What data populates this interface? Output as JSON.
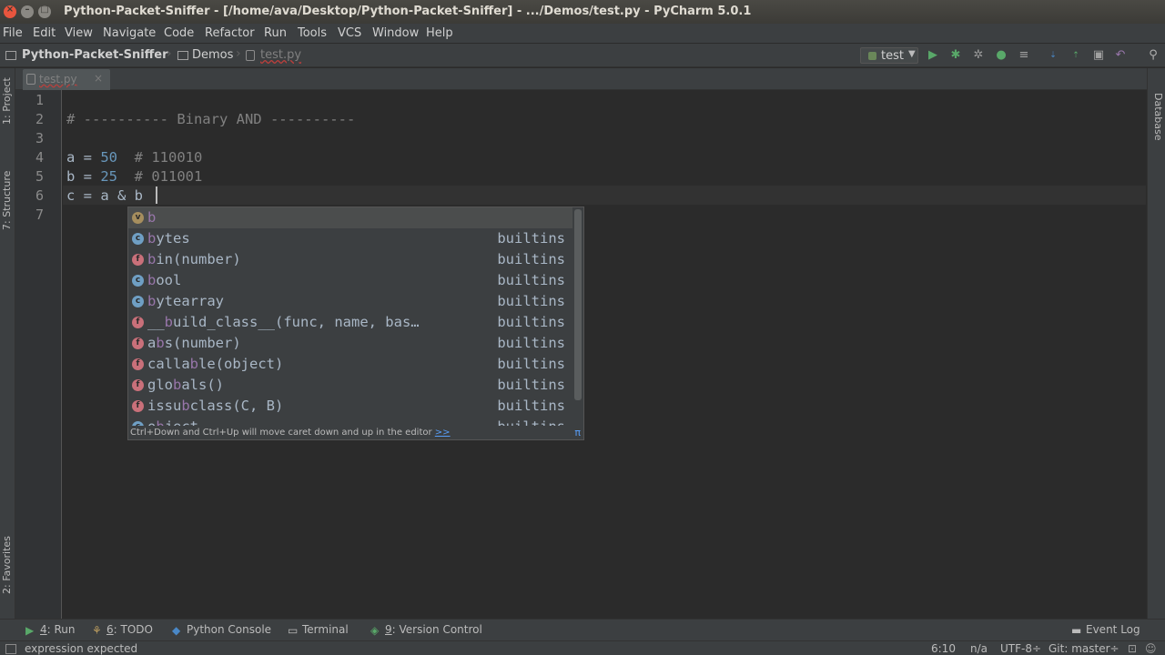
{
  "window": {
    "title": "Python-Packet-Sniffer - [/home/ava/Desktop/Python-Packet-Sniffer] - .../Demos/test.py - PyCharm 5.0.1"
  },
  "menu": {
    "items": [
      "File",
      "Edit",
      "View",
      "Navigate",
      "Code",
      "Refactor",
      "Run",
      "Tools",
      "VCS",
      "Window",
      "Help"
    ]
  },
  "navbar": {
    "project": "Python-Packet-Sniffer",
    "folder": "Demos",
    "file": "test.py",
    "run_config": "test"
  },
  "left_tool_tabs": [
    "1: Project",
    "7: Structure",
    "2: Favorites"
  ],
  "right_tool_tabs": [
    "Database"
  ],
  "editor": {
    "tab_name": "test.py",
    "line_numbers": [
      "1",
      "2",
      "3",
      "4",
      "5",
      "6",
      "7"
    ],
    "lines": {
      "l2_comment": "# ---------- Binary AND ----------",
      "l4_var": "a = ",
      "l4_num": "50",
      "l4_comment": "  # 110010",
      "l5_var": "b = ",
      "l5_num": "25",
      "l5_comment": "  # 011001",
      "l6_code": "c = a & b"
    }
  },
  "completion": {
    "items": [
      {
        "kind": "v",
        "pre": "",
        "hl": "b",
        "post": "",
        "origin": ""
      },
      {
        "kind": "c",
        "pre": "",
        "hl": "b",
        "post": "ytes",
        "origin": "builtins"
      },
      {
        "kind": "f",
        "pre": "",
        "hl": "b",
        "post": "in(number)",
        "origin": "builtins"
      },
      {
        "kind": "c",
        "pre": "",
        "hl": "b",
        "post": "ool",
        "origin": "builtins"
      },
      {
        "kind": "c",
        "pre": "",
        "hl": "b",
        "post": "ytearray",
        "origin": "builtins"
      },
      {
        "kind": "f",
        "pre": "__",
        "hl": "b",
        "post": "uild_class__(func, name, bas…",
        "origin": "builtins"
      },
      {
        "kind": "f",
        "pre": "a",
        "hl": "b",
        "post": "s(number)",
        "origin": "builtins"
      },
      {
        "kind": "f",
        "pre": "calla",
        "hl": "b",
        "post": "le(object)",
        "origin": "builtins"
      },
      {
        "kind": "f",
        "pre": "glo",
        "hl": "b",
        "post": "als()",
        "origin": "builtins"
      },
      {
        "kind": "f",
        "pre": "issu",
        "hl": "b",
        "post": "class(C, B)",
        "origin": "builtins"
      },
      {
        "kind": "c",
        "pre": "o",
        "hl": "b",
        "post": "ject",
        "origin": "builtins"
      }
    ],
    "hint": "Ctrl+Down and Ctrl+Up will move caret down and up in the editor",
    "hint_link": ">>",
    "pi": "π"
  },
  "tool_windows": {
    "run_num": "4",
    "run": ": Run",
    "todo_num": "6",
    "todo": ": TODO",
    "python_console": "Python Console",
    "terminal": "Terminal",
    "vcs_num": "9",
    "vcs": ": Version Control",
    "event_log": "Event Log"
  },
  "status": {
    "message": "expression expected",
    "position": "6:10",
    "line_sep": "n/a",
    "encoding": "UTF-8÷",
    "git": "Git: master÷"
  },
  "colors": {
    "background": "#2b2b2b",
    "number": "#6897bb",
    "comment": "#808080",
    "highlight": "#9876aa"
  }
}
